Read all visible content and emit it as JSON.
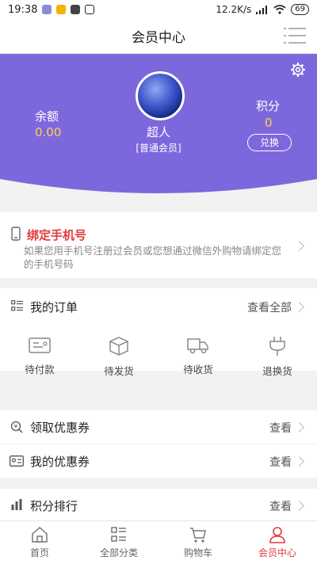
{
  "status_bar": {
    "time": "19:38",
    "network": "12.2K/s",
    "battery": "69"
  },
  "header": {
    "title": "会员中心",
    "menu_icon": "menu-lines-icon"
  },
  "profile": {
    "balance_label": "余额",
    "balance_value": "0.00",
    "username": "超人",
    "level": "[普通会员]",
    "points_label": "积分",
    "points_value": "0",
    "exchange_label": "兑换",
    "settings_icon": "gear-icon",
    "colors": {
      "hero_bg": "#7d67dc",
      "value_color": "#ffd24a"
    }
  },
  "bind_phone": {
    "title": "绑定手机号",
    "description": "如果您用手机号注册过会员或您想通过微信外购物请绑定您的手机号码"
  },
  "orders": {
    "title": "我的订单",
    "view_all": "查看全部",
    "items": [
      {
        "label": "待付款",
        "icon": "wallet-icon"
      },
      {
        "label": "待发货",
        "icon": "box-icon"
      },
      {
        "label": "待收货",
        "icon": "truck-icon"
      },
      {
        "label": "退换货",
        "icon": "plug-icon"
      }
    ]
  },
  "coupons": {
    "get_title": "领取优惠券",
    "get_more": "查看",
    "my_title": "我的优惠券",
    "my_more": "查看"
  },
  "ranking": {
    "title": "积分排行",
    "more": "查看"
  },
  "tabbar": {
    "items": [
      {
        "label": "首页",
        "icon": "home-icon"
      },
      {
        "label": "全部分类",
        "icon": "category-icon"
      },
      {
        "label": "购物车",
        "icon": "cart-icon"
      },
      {
        "label": "会员中心",
        "icon": "user-icon",
        "active": true
      }
    ],
    "active_color": "#e23a3a"
  }
}
